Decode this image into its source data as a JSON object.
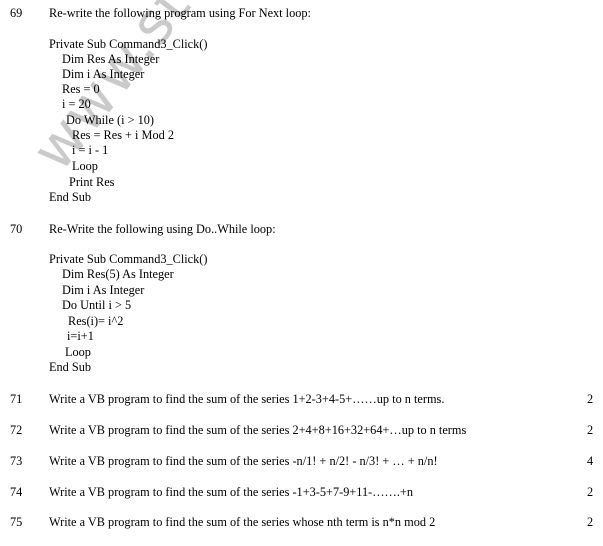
{
  "watermark": "www.studiestoday",
  "questions": [
    {
      "number": "69",
      "text": "Re-write the following program using For Next loop:",
      "code": [
        "Private Sub Command3_Click()",
        "Dim Res As Integer",
        "Dim i As Integer",
        "Res = 0",
        "i = 20",
        "Do While (i > 10)",
        "Res = Res + i Mod 2",
        "i = i - 1",
        "Loop",
        "Print Res",
        "End Sub"
      ]
    },
    {
      "number": "70",
      "text": "Re-Write the following using Do..While loop:",
      "code": [
        "Private Sub Command3_Click()",
        "Dim Res(5) As Integer",
        "Dim i As Integer",
        "Do Until i > 5",
        "Res(i)= i^2",
        "i=i+1",
        "Loop",
        "End Sub"
      ]
    },
    {
      "number": "71",
      "text": "Write a VB program to find the sum of the series 1+2-3+4-5+……up to n terms.",
      "marks": "2"
    },
    {
      "number": "72",
      "text": "Write a VB program to find the sum of the series 2+4+8+16+32+64+…up to n terms",
      "marks": "2"
    },
    {
      "number": "73",
      "text": "Write a VB program to find the sum of the series -n/1! + n/2! - n/3! + … + n/n!",
      "marks": "4"
    },
    {
      "number": "74",
      "text": "Write a VB program to find the sum of the series -1+3-5+7-9+11-…….+n",
      "marks": "2"
    },
    {
      "number": "75",
      "text": "Write a VB program to find the sum of the series whose nth term is n*n mod 2",
      "marks": "2"
    }
  ]
}
